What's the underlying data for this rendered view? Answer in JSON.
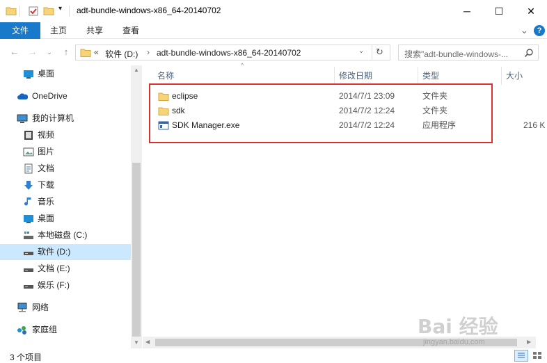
{
  "window": {
    "title": "adt-bundle-windows-x86_64-20140702",
    "controls": {
      "minimize": "─",
      "maximize": "☐",
      "close": "✕"
    }
  },
  "ribbon": {
    "tabs": [
      {
        "label": "文件",
        "active": true
      },
      {
        "label": "主页"
      },
      {
        "label": "共享"
      },
      {
        "label": "查看"
      }
    ],
    "expand_glyph": "⌄",
    "help_glyph": "?"
  },
  "address": {
    "chevron": "«",
    "segments": [
      "软件 (D:)",
      "adt-bundle-windows-x86_64-20140702"
    ],
    "separator": "›",
    "search_placeholder": "搜索\"adt-bundle-windows-..."
  },
  "nav": {
    "items": [
      {
        "label": "桌面",
        "icon": "desktop-icon"
      },
      {
        "label": "OneDrive",
        "icon": "cloud-icon"
      },
      {
        "label": "我的计算机",
        "icon": "computer-icon"
      },
      {
        "label": "视频",
        "icon": "video-icon"
      },
      {
        "label": "图片",
        "icon": "picture-icon"
      },
      {
        "label": "文档",
        "icon": "document-icon"
      },
      {
        "label": "下载",
        "icon": "download-icon"
      },
      {
        "label": "音乐",
        "icon": "music-icon"
      },
      {
        "label": "桌面",
        "icon": "desktop-icon"
      },
      {
        "label": "本地磁盘 (C:)",
        "icon": "drive-icon"
      },
      {
        "label": "软件 (D:)",
        "icon": "drive-icon",
        "selected": true
      },
      {
        "label": "文档 (E:)",
        "icon": "drive-icon"
      },
      {
        "label": "娱乐 (F:)",
        "icon": "drive-icon"
      },
      {
        "label": "网络",
        "icon": "network-icon"
      },
      {
        "label": "家庭组",
        "icon": "homegroup-icon"
      }
    ]
  },
  "columns": {
    "name": "名称",
    "modified": "修改日期",
    "type": "类型",
    "size": "大小"
  },
  "files": [
    {
      "name": "eclipse",
      "modified": "2014/7/1 23:09",
      "type": "文件夹",
      "size": "",
      "icon": "folder-icon"
    },
    {
      "name": "sdk",
      "modified": "2014/7/2 12:24",
      "type": "文件夹",
      "size": "",
      "icon": "folder-icon"
    },
    {
      "name": "SDK Manager.exe",
      "modified": "2014/7/2 12:24",
      "type": "应用程序",
      "size": "216 K",
      "icon": "application-icon"
    }
  ],
  "status": {
    "text": "3 个项目"
  },
  "watermark": {
    "brand": "Bai 经验",
    "url": "jingyan.baidu.com"
  },
  "colors": {
    "accent": "#1979ca",
    "selection": "#cce8ff",
    "highlight_box": "#d9322e",
    "folder": "#f7d37a"
  }
}
